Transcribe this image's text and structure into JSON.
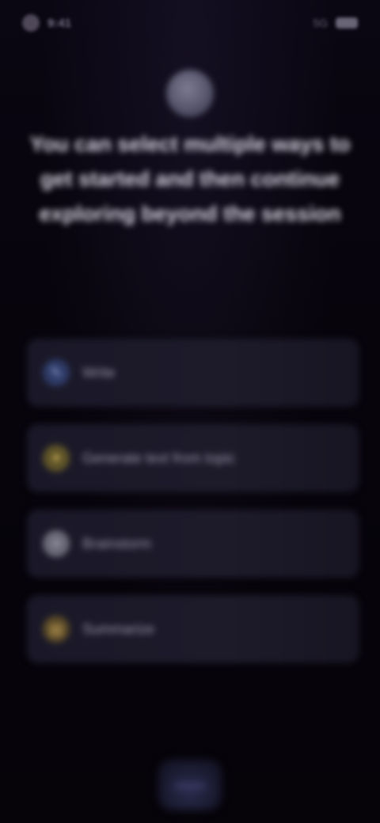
{
  "status_bar": {
    "time": "9:41",
    "signal": "5G"
  },
  "icons": {
    "status_avatar": "avatar-dot",
    "battery": "battery-icon",
    "hero": "app-logo-orb"
  },
  "headline": "You can select multiple ways to get started and then continue exploring beyond the session",
  "options": [
    {
      "label": "Write",
      "icon": "pencil-icon",
      "icon_color": "#3a4a7a"
    },
    {
      "label": "Generate text from topic",
      "icon": "lightbulb-icon",
      "icon_color": "#8a7a3a"
    },
    {
      "label": "Brainstorm",
      "icon": "sparkle-icon",
      "icon_color": "#8a8898"
    },
    {
      "label": "Summarize",
      "icon": "document-icon",
      "icon_color": "#8a7440"
    }
  ],
  "colors": {
    "background": "#07040c",
    "card": "#1c1a29",
    "text": "#d9d6e3"
  }
}
